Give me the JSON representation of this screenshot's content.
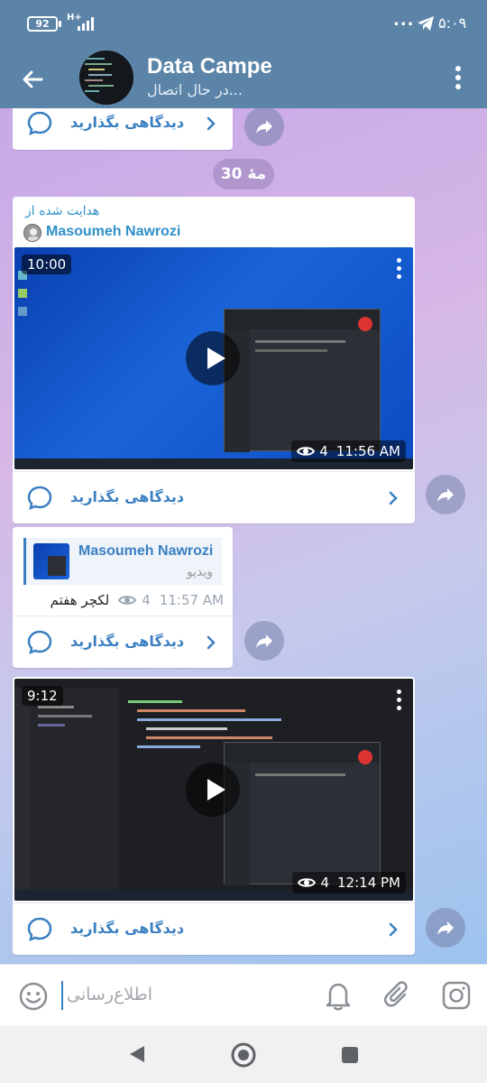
{
  "status_bar": {
    "battery": "92",
    "network": "H+",
    "time": "۵:۰۹",
    "dots": "..."
  },
  "header": {
    "title": "Data Campe",
    "subtitle": "در حال اتصال..."
  },
  "chat": {
    "date_badge": "30 مهٔ",
    "comment_label": "دیدگاهی بگذارید",
    "messages": {
      "forwarded_video": {
        "forwarded_label": "هدایت شده از",
        "author": "Masoumeh Nawrozi",
        "duration": "10:00",
        "views": "4",
        "time": "11:56 AM"
      },
      "reply_message": {
        "reply_author": "Masoumeh Nawrozi",
        "reply_type": "ویدیو",
        "text": "لکچر هفتم",
        "views": "4",
        "time": "11:57 AM"
      },
      "second_video": {
        "duration": "9:12",
        "views": "4",
        "time": "12:14 PM"
      }
    }
  },
  "composer": {
    "placeholder": "اطلاع‌رسانی"
  },
  "colors": {
    "header_bg": "#5b84a8",
    "accent": "#3a7fc1",
    "link": "#2f8fc9"
  }
}
